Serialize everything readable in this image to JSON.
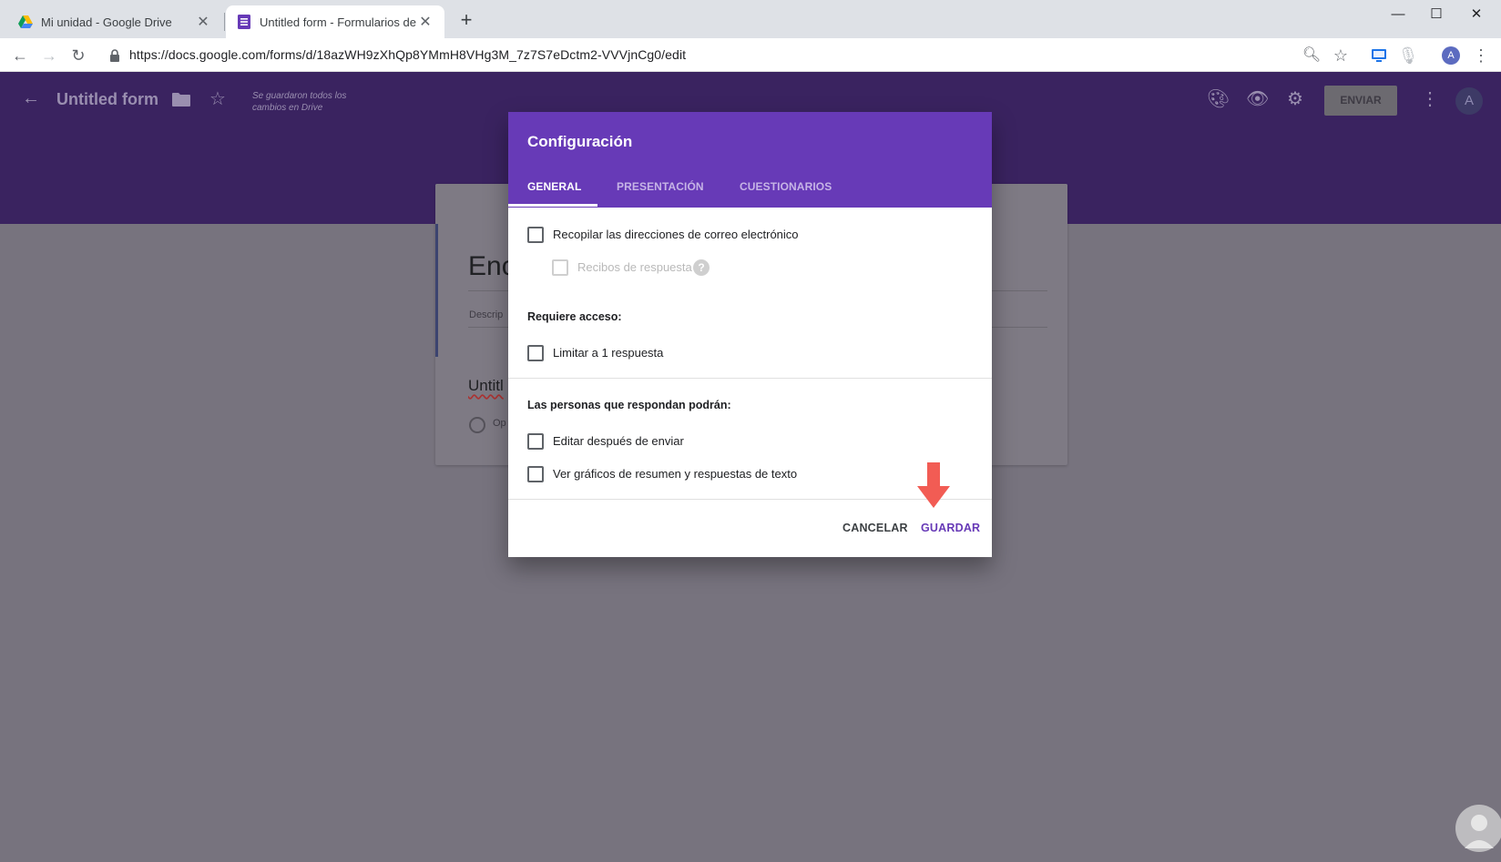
{
  "browser": {
    "tabs": [
      {
        "title": "Mi unidad - Google Drive",
        "icon": "google-drive-icon"
      },
      {
        "title": "Untitled form - Formularios de G",
        "icon": "google-forms-icon"
      }
    ],
    "url": "https://docs.google.com/forms/d/18azWH9zXhQp8YMmH8VHg3M_7z7S7eDctm2-VVVjnCg0/edit",
    "profile_initial": "A"
  },
  "app": {
    "form_title": "Untitled form",
    "saved_status": "Se guardaron todos los cambios en Drive",
    "send_label": "ENVIAR",
    "avatar_initial": "A",
    "peek": {
      "title": "Enc",
      "description": "Descrip",
      "question": "Untitl",
      "option": "Op"
    }
  },
  "dialog": {
    "title": "Configuración",
    "tabs": [
      "GENERAL",
      "PRESENTACIÓN",
      "CUESTIONARIOS"
    ],
    "active_tab": "GENERAL",
    "options": {
      "collect_emails": "Recopilar las direcciones de correo electrónico",
      "response_receipts": "Recibos de respuesta",
      "requires_access": "Requiere acceso:",
      "limit_one": "Limitar a 1 respuesta",
      "respondents_can": "Las personas que respondan podrán:",
      "edit_after": "Editar después de enviar",
      "view_charts": "Ver gráficos de resumen y respuestas de texto"
    },
    "cancel_label": "CANCELAR",
    "save_label": "GUARDAR",
    "accent_color": "#673ab7"
  }
}
